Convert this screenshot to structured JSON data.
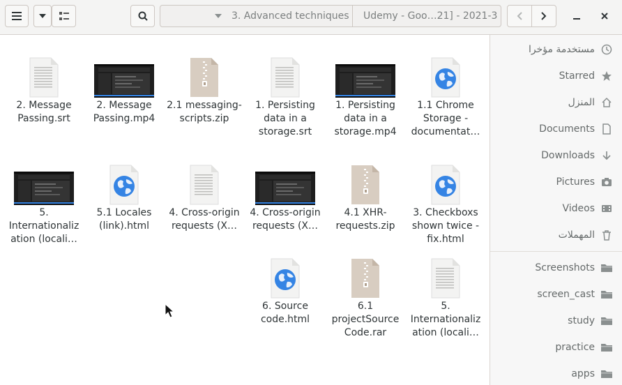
{
  "toolbar": {
    "breadcrumbs": [
      "3. Advanced techniques",
      "Udemy - Goo…21] - 2021-3"
    ]
  },
  "files": [
    {
      "label": "2. Message Passing.srt",
      "icon": "text-file-icon"
    },
    {
      "label": "2. Message Passing.mp4",
      "icon": "video-thumbnail-icon"
    },
    {
      "label": "2.1 messaging-scripts.zip",
      "icon": "archive-icon"
    },
    {
      "label": "1. Persisting data in a storage.srt",
      "icon": "text-file-icon"
    },
    {
      "label": "1. Persisting data in a storage.mp4",
      "icon": "video-thumbnail-icon"
    },
    {
      "label": "1.1 Chrome Storage - documentat…",
      "icon": "html-file-icon"
    },
    {
      "label": "5. Internationaliz ation (locali…",
      "icon": "video-thumbnail-icon"
    },
    {
      "label": "5.1 Locales (link).html",
      "icon": "html-file-icon"
    },
    {
      "label": "4. Cross-origin requests (X…",
      "icon": "text-file-icon"
    },
    {
      "label": "4. Cross-origin requests (X…",
      "icon": "video-thumbnail-icon"
    },
    {
      "label": "4.1 XHR-requests.zip",
      "icon": "archive-icon"
    },
    {
      "label": "3. Checkboxs shown twice - fix.html",
      "icon": "html-file-icon"
    },
    {
      "label": "6. Source code.html",
      "icon": "html-file-icon"
    },
    {
      "label": "6.1 projectSource Code.rar",
      "icon": "archive-icon"
    },
    {
      "label": "5. Internationaliz ation (locali…",
      "icon": "text-file-icon"
    }
  ],
  "sidebar": {
    "places": [
      {
        "label": "مستخدمة مؤخرا",
        "icon": "recent-icon"
      },
      {
        "label": "Starred",
        "icon": "star-icon"
      },
      {
        "label": "المنزل",
        "icon": "home-icon"
      },
      {
        "label": "Documents",
        "icon": "document-icon"
      },
      {
        "label": "Downloads",
        "icon": "download-icon"
      },
      {
        "label": "Pictures",
        "icon": "camera-icon"
      },
      {
        "label": "Videos",
        "icon": "video-icon"
      },
      {
        "label": "المهملات",
        "icon": "trash-icon"
      }
    ],
    "bookmarks": [
      {
        "label": "Screenshots",
        "icon": "folder-icon"
      },
      {
        "label": "screen_cast",
        "icon": "folder-icon"
      },
      {
        "label": "study",
        "icon": "folder-icon"
      },
      {
        "label": "practice",
        "icon": "folder-icon"
      },
      {
        "label": "apps",
        "icon": "folder-icon"
      }
    ]
  },
  "colors": {
    "accent": "#3584e4",
    "archive": "#d3c6b8",
    "sidebar_icon": "#8a8f8f"
  }
}
